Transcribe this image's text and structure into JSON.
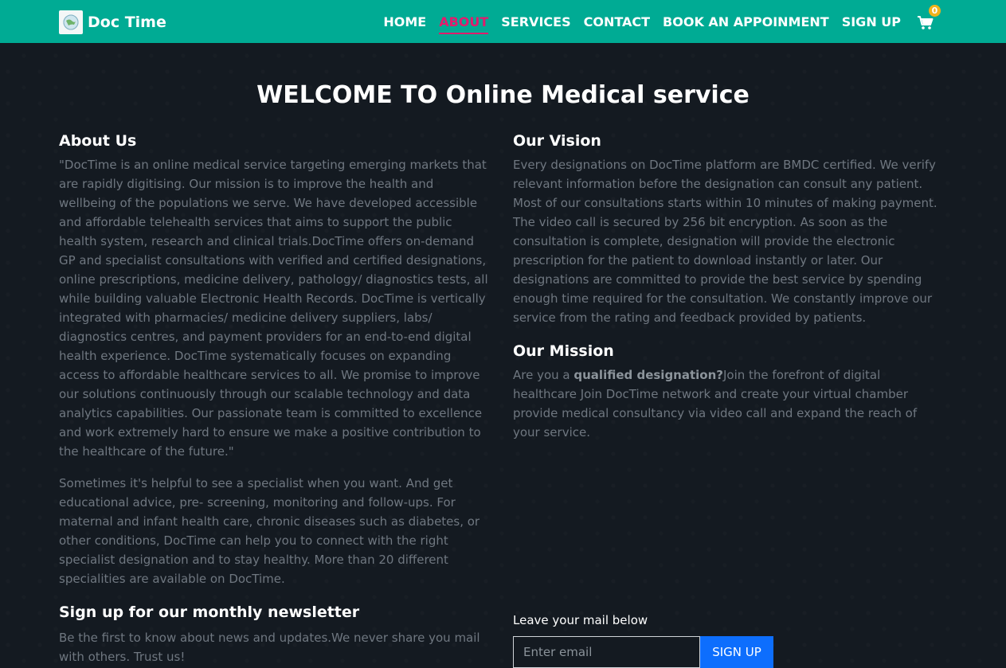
{
  "brand": {
    "name": "Doc Time",
    "logo_icon": "globe-logo-icon"
  },
  "nav": {
    "items": [
      "HOME",
      "ABOUT",
      "SERVICES",
      "CONTACT",
      "BOOK AN APPOINMENT",
      "SIGN UP"
    ],
    "active": "ABOUT",
    "cart_icon": "shopping-cart-icon",
    "cart_count": "0"
  },
  "colors": {
    "navbar": "#00ab94",
    "active_link": "#e21b6d",
    "badge": "#f0b31b",
    "button": "#0d6efd",
    "background": "#141a21"
  },
  "welcome": "WELCOME TO Online Medical service",
  "about": {
    "title": "About Us",
    "paragraph1": "\"DocTime is an online medical service targeting emerging markets that are rapidly digitising. Our mission is to improve the health and wellbeing of the populations we serve. We have developed accessible and affordable telehealth services that aims to support the public health system, research and clinical trials.DocTime offers on-demand GP and specialist consultations with verified and certified designations, online prescriptions, medicine delivery, pathology/ diagnostics tests, all while building valuable Electronic Health Records. DocTime is vertically integrated with pharmacies/ medicine delivery suppliers, labs/ diagnostics centres, and payment providers for an end-to-end digital health experience. DocTime systematically focuses on expanding access to affordable healthcare services to all. We promise to improve our solutions continuously through our scalable technology and data analytics capabilities. Our passionate team is committed to excellence and work extremely hard to ensure we make a positive contribution to the healthcare of the future.\"",
    "paragraph2": "Sometimes it's helpful to see a specialist when you want. And get educational advice, pre- screening, monitoring and follow-ups. For maternal and infant health care, chronic diseases such as diabetes, or other conditions, DocTime can help you to connect with the right specialist designation and to stay healthy. More than 20 different specialities are available on DocTime."
  },
  "vision": {
    "title": "Our Vision",
    "text": "Every designations on DocTime platform are BMDC certified. We verify relevant information before the designation can consult any patient. Most of our consultations starts within 10 minutes of making payment. The video call is secured by 256 bit encryption. As soon as the consultation is complete, designation will provide the electronic prescription for the patient to download instantly or later. Our designations are committed to provide the best service by spending enough time required for the consultation. We constantly improve our service from the rating and feedback provided by patients."
  },
  "mission": {
    "title": "Our Mission",
    "prefix": "Are you a ",
    "bold": "qualified designation?",
    "rest": "Join the forefront of digital healthcare Join DocTime network and create your virtual chamber provide medical consultancy via video call and expand the reach of your service."
  },
  "newsletter": {
    "title": "Sign up for our monthly newsletter",
    "text": "Be the first to know about news and updates.We never share you mail with others. Trust us!",
    "mail_label": "Leave your mail below",
    "email_placeholder": "Enter email",
    "button": "SIGN UP"
  }
}
